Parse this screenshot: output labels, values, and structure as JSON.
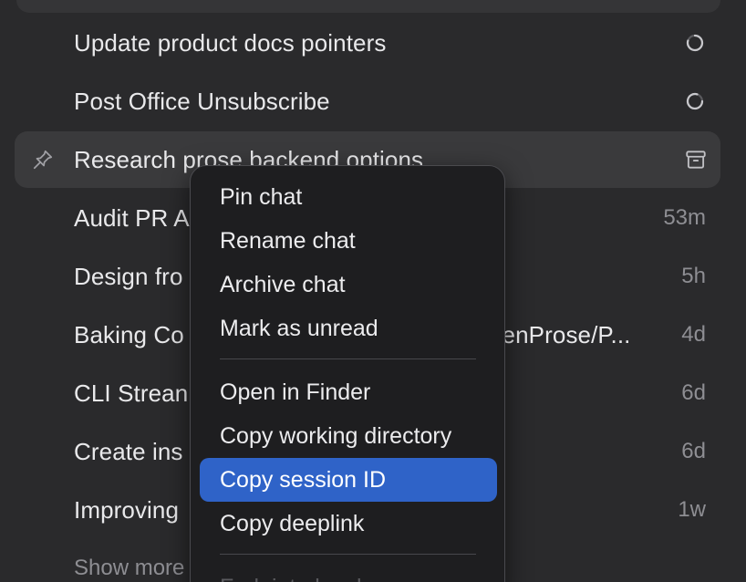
{
  "chats": [
    {
      "title": "Update product docs pointers",
      "status": "spinner"
    },
    {
      "title": "Post Office Unsubscribe",
      "status": "spinner"
    },
    {
      "title": "Research prose backend options",
      "status": "archive",
      "pinnable": true
    },
    {
      "title": "Audit PR A",
      "time": "53m"
    },
    {
      "title": "Design fro",
      "time": "5h"
    },
    {
      "title": "Baking Co",
      "title_tail": "penProse/P...",
      "time": "4d"
    },
    {
      "title": "CLI Strean",
      "time": "6d"
    },
    {
      "title": "Create ins",
      "time": "6d"
    },
    {
      "title": "Improving",
      "time": "1w"
    }
  ],
  "show_more_label": "Show more",
  "context_menu": {
    "items": [
      {
        "label": "Pin chat"
      },
      {
        "label": "Rename chat"
      },
      {
        "label": "Archive chat"
      },
      {
        "label": "Mark as unread"
      },
      {
        "label": "Open in Finder"
      },
      {
        "label": "Copy working directory"
      },
      {
        "label": "Copy session ID",
        "selected": true
      },
      {
        "label": "Copy deeplink"
      },
      {
        "label": "Fork into local"
      }
    ]
  },
  "colors": {
    "background": "#2a2a2c",
    "hover_row": "#3a3a3c",
    "menu_background": "#1e1e20",
    "selected_item": "#2f63c8",
    "muted_text": "#8e8e93"
  },
  "icons": {
    "pin": "pin-icon",
    "archive": "archive-icon",
    "spinner": "loading-spinner-icon"
  }
}
